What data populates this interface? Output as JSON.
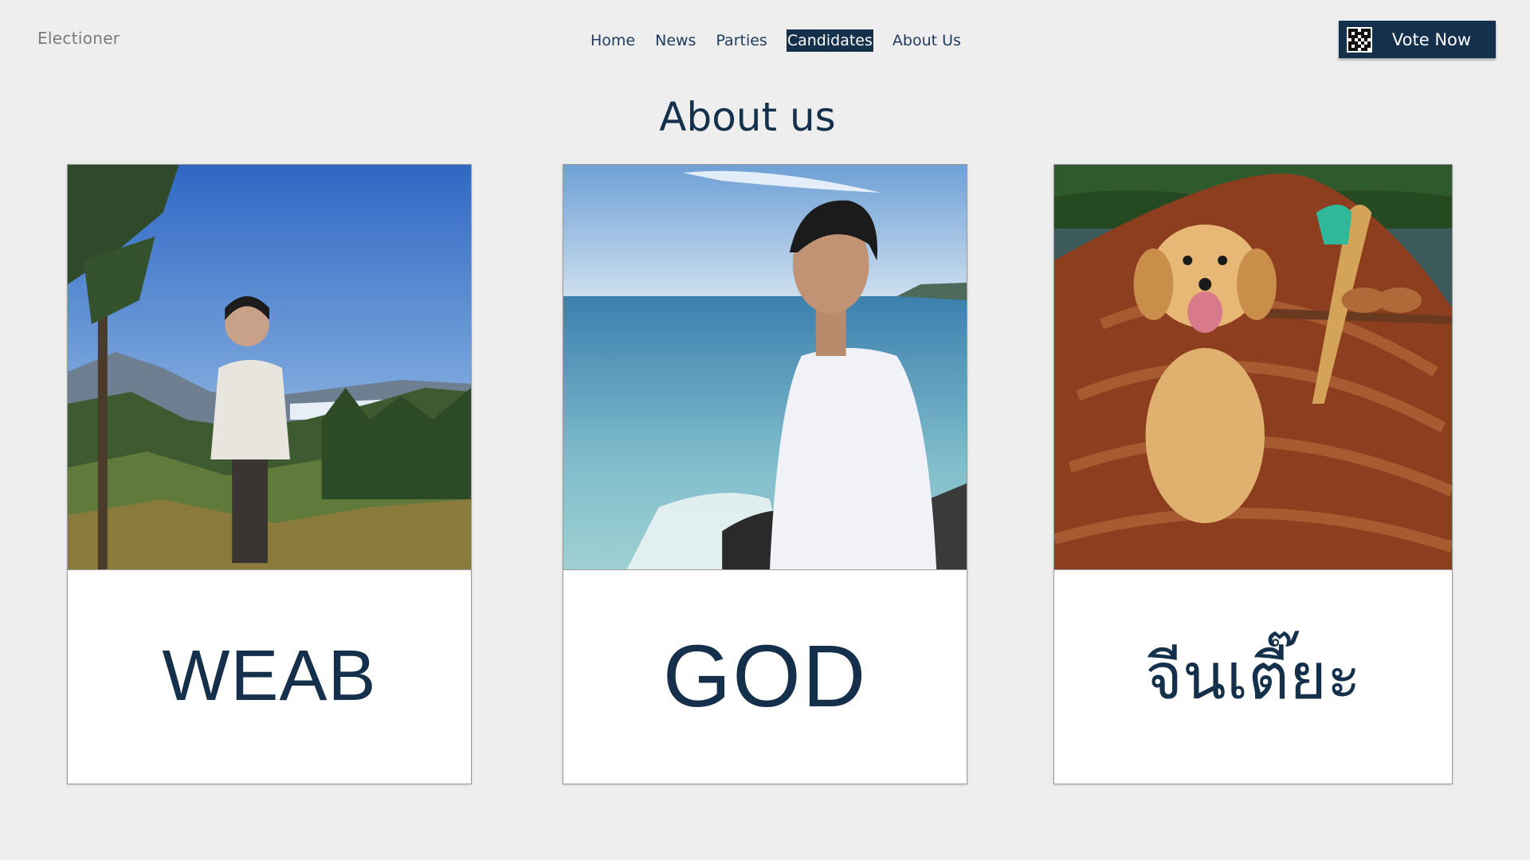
{
  "header": {
    "brand": "Electioner",
    "nav": [
      {
        "label": "Home",
        "active": false
      },
      {
        "label": "News",
        "active": false
      },
      {
        "label": "Parties",
        "active": false
      },
      {
        "label": "Candidates",
        "active": true
      },
      {
        "label": "About Us",
        "active": false
      }
    ],
    "vote_button": {
      "label": "Vote Now",
      "icon": "qr-code-icon"
    }
  },
  "main": {
    "title": "About us",
    "cards": [
      {
        "name": "WEAB",
        "photo": "person-on-mountain-photo"
      },
      {
        "name": "GOD",
        "photo": "person-by-sea-photo"
      },
      {
        "name": "จีนเตี๊ยะ",
        "photo": "puppy-in-boat-photo"
      }
    ]
  },
  "colors": {
    "background": "#eeeeee",
    "navy": "#15304b",
    "brand_gray": "#7a7a7a"
  }
}
